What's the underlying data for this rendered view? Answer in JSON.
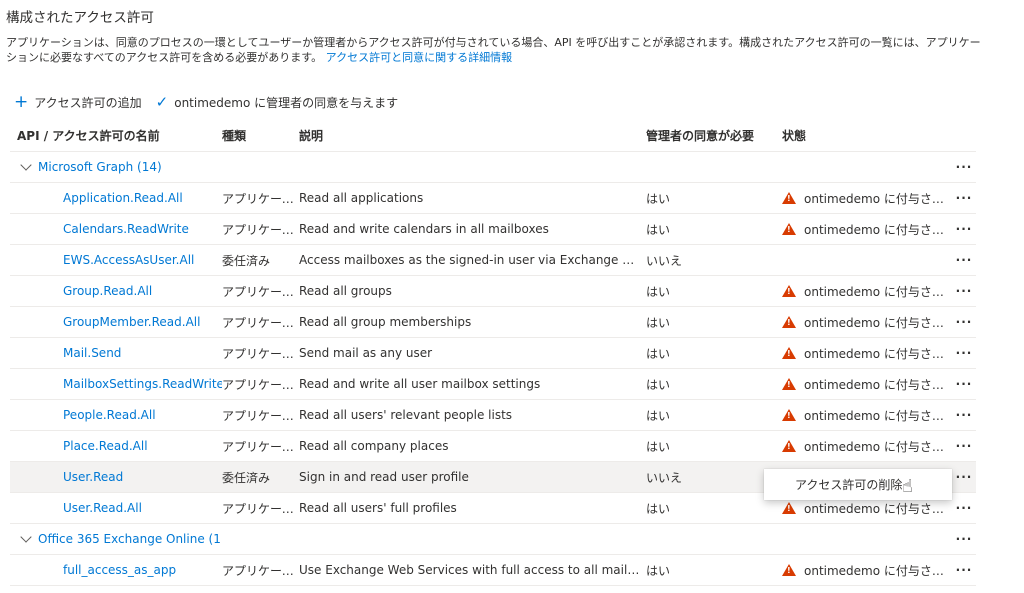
{
  "section_title": "構成されたアクセス許可",
  "description": "アプリケーションは、同意のプロセスの一環としてユーザーか管理者からアクセス許可が付与されている場合、API を呼び出すことが承認されます。構成されたアクセス許可の一覧には、アプリケーションに必要なすべてのアクセス許可を含める必要があります。",
  "description_link": "アクセス許可と同意に関する詳細情報",
  "toolbar": {
    "add_label": "アクセス許可の追加",
    "consent_label": "ontimedemo に管理者の同意を与えます"
  },
  "columns": {
    "name": "API / アクセス許可の名前",
    "type": "種類",
    "description": "説明",
    "admin_consent": "管理者の同意が必要",
    "status": "状態"
  },
  "groups": {
    "graph": {
      "label": "Microsoft Graph (14)",
      "rows": [
        {
          "name": "Application.Read.All",
          "type": "アプリケーション",
          "desc": "Read all applications",
          "consent": "はい",
          "status": "ontimedemo に付与されていません"
        },
        {
          "name": "Calendars.ReadWrite",
          "type": "アプリケーション",
          "desc": "Read and write calendars in all mailboxes",
          "consent": "はい",
          "status": "ontimedemo に付与されていません"
        },
        {
          "name": "EWS.AccessAsUser.All",
          "type": "委任済み",
          "desc": "Access mailboxes as the signed-in user via Exchange Web Services",
          "consent": "いいえ",
          "status": ""
        },
        {
          "name": "Group.Read.All",
          "type": "アプリケーション",
          "desc": "Read all groups",
          "consent": "はい",
          "status": "ontimedemo に付与されていません"
        },
        {
          "name": "GroupMember.Read.All",
          "type": "アプリケーション",
          "desc": "Read all group memberships",
          "consent": "はい",
          "status": "ontimedemo に付与されていません"
        },
        {
          "name": "Mail.Send",
          "type": "アプリケーション",
          "desc": "Send mail as any user",
          "consent": "はい",
          "status": "ontimedemo に付与されていません"
        },
        {
          "name": "MailboxSettings.ReadWrite",
          "type": "アプリケーション",
          "desc": "Read and write all user mailbox settings",
          "consent": "はい",
          "status": "ontimedemo に付与されていません"
        },
        {
          "name": "People.Read.All",
          "type": "アプリケーション",
          "desc": "Read all users' relevant people lists",
          "consent": "はい",
          "status": "ontimedemo に付与されていません"
        },
        {
          "name": "Place.Read.All",
          "type": "アプリケーション",
          "desc": "Read all company places",
          "consent": "はい",
          "status": "ontimedemo に付与されていません"
        },
        {
          "name": "User.Read",
          "type": "委任済み",
          "desc": "Sign in and read user profile",
          "consent": "いいえ",
          "status": ""
        },
        {
          "name": "User.Read.All",
          "type": "アプリケーション",
          "desc": "Read all users' full profiles",
          "consent": "はい",
          "status": "ontimedemo に付与されていません"
        }
      ]
    },
    "exchange": {
      "label": "Office 365 Exchange Online (1",
      "rows": [
        {
          "name": "full_access_as_app",
          "type": "アプリケーション",
          "desc": "Use Exchange Web Services with full access to all mailboxes",
          "consent": "はい",
          "status": "ontimedemo に付与されていません"
        }
      ]
    }
  },
  "more_label": "···",
  "context_menu": {
    "remove_label": "アクセス許可の削除"
  },
  "icons": {
    "add": "plus-icon",
    "consent": "check-icon",
    "expand": "chevron-down-icon",
    "warning": "warning-icon",
    "cursor": "hand-pointer-icon"
  },
  "colors": {
    "link": "#0078d4",
    "warning": "#d83b01",
    "selected_row": "#f3f2f1"
  }
}
